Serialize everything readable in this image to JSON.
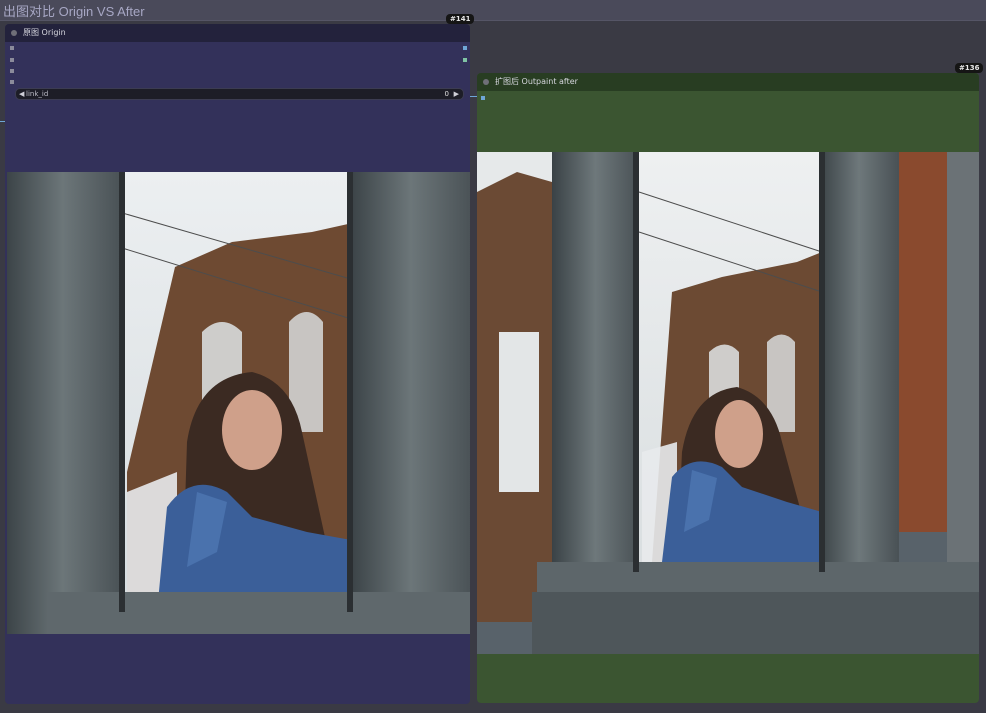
{
  "group": {
    "title": "出图对比 Origin VS After"
  },
  "nodes": {
    "origin": {
      "title": "原图 Origin",
      "badge": "#141",
      "widget": {
        "label": "link_id",
        "value": "0"
      },
      "accent": "#33315a"
    },
    "after": {
      "title": "扩图后 Outpaint after",
      "badge": "#136",
      "accent": "#3b5531"
    }
  },
  "image_subject": "woman in denim jacket looking through window frame, bridge in background",
  "colors": {
    "canvas": "#3a3a44",
    "link": "#6fa6d6"
  }
}
